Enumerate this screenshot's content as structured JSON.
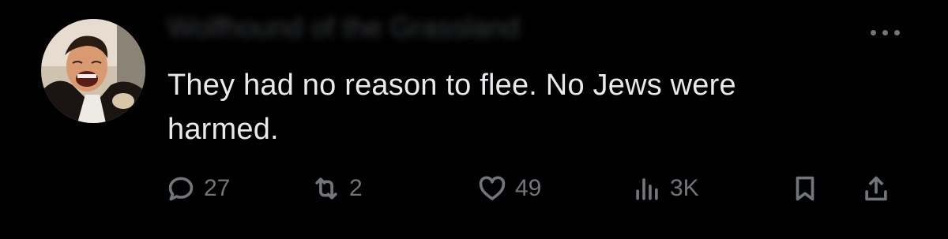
{
  "post": {
    "text": "They had no reason to flee.  No Jews were\nharmed.",
    "header_blurred": "Wolfhound of the Grassland",
    "avatar_icon": "avatar-laughing-man-icon"
  },
  "actions": {
    "reply_count": "27",
    "repost_count": "2",
    "like_count": "49",
    "view_count": "3K"
  },
  "colors": {
    "background": "#000000",
    "text": "#e7e9ea",
    "muted": "#71767b"
  }
}
